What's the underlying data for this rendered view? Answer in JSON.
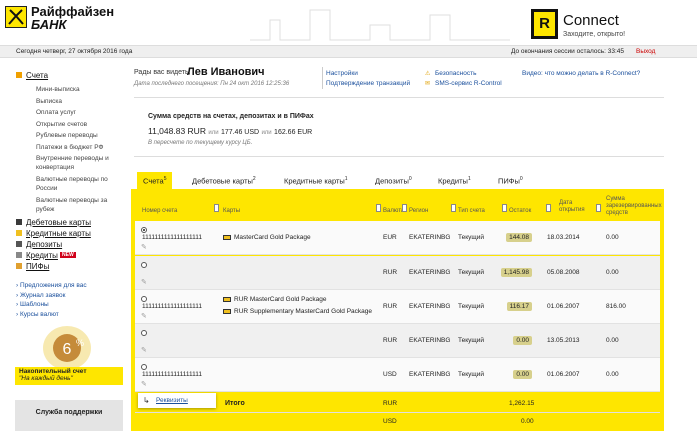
{
  "bank": {
    "name_line1": "Райффайзен",
    "name_line2": "БАНК"
  },
  "connect": {
    "badge": "R",
    "name": "Connect",
    "tagline": "Заходите, открыто!"
  },
  "status": {
    "date": "Сегодня четверг, 27 октября 2016 года",
    "session": "До окончания сессии осталось: 33:45",
    "logout": "Выход"
  },
  "sidebar": {
    "accounts": "Счета",
    "sub": [
      "Мини-выписка",
      "Выписка",
      "Оплата услуг",
      "Открытие счетов",
      "Рублевые переводы",
      "Платежи в бюджет РФ",
      "Внутренние переводы и",
      "конвертация",
      "Валютные переводы по",
      "России",
      "Валютные переводы за",
      "рубеж"
    ],
    "debit": "Дебетовые карты",
    "credit_cards": "Кредитные карты",
    "deposits": "Депозиты",
    "credits": "Кредиты",
    "new_badge": "NEW",
    "funds": "ПИФы",
    "links": [
      "Предложения для вас",
      "Журнал заявок",
      "Шаблоны",
      "Курсы валют"
    ],
    "promo_title": "Накопительный счет",
    "promo_sub": "\"На каждый день\"",
    "support": "Служба поддержки"
  },
  "greeting": {
    "label": "Рады вас видеть,",
    "name": "Лев Иванович",
    "last_visit": "Дата последнего посещения: Пн 24 окт 2016 12:25:36"
  },
  "top_links": {
    "settings": "Настройки",
    "confirm": "Подтверждение транзакций",
    "security": "Безопасность",
    "sms": "SMS-сервис R-Control",
    "video": "Видео: что можно делать в R-Connect?"
  },
  "summary": {
    "title": "Сумма средств на счетах, депозитах и в ПИФах",
    "rur": "11,048.83 RUR",
    "or1": "или",
    "usd": "177.46 USD",
    "or2": "или",
    "eur": "162.66 EUR",
    "note": "В пересчете по текущему курсу ЦБ."
  },
  "tabs": [
    {
      "label": "Счета",
      "count": "5"
    },
    {
      "label": "Дебетовые карты",
      "count": "2"
    },
    {
      "label": "Кредитные карты",
      "count": "1"
    },
    {
      "label": "Депозиты",
      "count": "0"
    },
    {
      "label": "Кредиты",
      "count": "1"
    },
    {
      "label": "ПИФы",
      "count": "0"
    }
  ],
  "table": {
    "headers": [
      "Номер счета",
      "Карты",
      "Валюта",
      "Регион",
      "Тип счета",
      "Остаток",
      "Дата открытия",
      "Сумма зарезервированных средств"
    ],
    "rows": [
      {
        "number": "1111111111111111111",
        "cards": [
          "MasterCard Gold Package"
        ],
        "currency": "EUR",
        "region": "EKATERINBG",
        "type": "Текущий",
        "balance": "144.08",
        "opened": "18.03.2014",
        "reserved": "0.00",
        "selected": true
      },
      {
        "number": "",
        "cards": [],
        "currency": "RUR",
        "region": "EKATERINBG",
        "type": "Текущий",
        "balance": "1,145.98",
        "opened": "05.08.2008",
        "reserved": "0.00",
        "selected": false
      },
      {
        "number": "1111111111111111111",
        "cards": [
          "RUR MasterCard Gold Package",
          "RUR Supplementary MasterCard Gold Package"
        ],
        "currency": "RUR",
        "region": "EKATERINBG",
        "type": "Текущий",
        "balance": "116.17",
        "opened": "01.06.2007",
        "reserved": "816.00",
        "selected": false
      },
      {
        "number": "",
        "cards": [],
        "currency": "RUR",
        "region": "EKATERINBG",
        "type": "Текущий",
        "balance": "0.00",
        "opened": "13.05.2013",
        "reserved": "0.00",
        "selected": false
      },
      {
        "number": "1111111111111111111",
        "cards": [],
        "currency": "USD",
        "region": "EKATERINBG",
        "type": "Текущий",
        "balance": "0.00",
        "opened": "01.06.2007",
        "reserved": "0.00",
        "selected": false
      }
    ],
    "requisites": "Реквизиты",
    "total_label": "Итого",
    "totals": [
      {
        "currency": "RUR",
        "value": "1,262.15"
      },
      {
        "currency": "USD",
        "value": "0.00"
      }
    ]
  }
}
